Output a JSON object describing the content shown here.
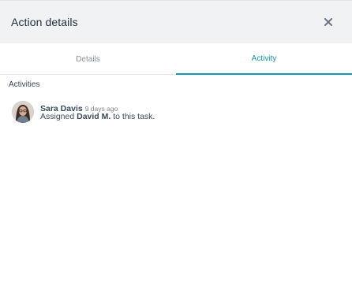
{
  "header": {
    "title": "Action details",
    "close_icon": "close-icon"
  },
  "tabs": [
    {
      "label": "Details",
      "active": false
    },
    {
      "label": "Activity",
      "active": true
    }
  ],
  "activities": {
    "section_label": "Activities",
    "items": [
      {
        "actor": "Sara Davis",
        "time": "9 days ago",
        "text_prefix": "Assigned",
        "target": "David M.",
        "text_suffix": "to this task.",
        "avatar_icon": "user-avatar"
      }
    ]
  },
  "colors": {
    "accent": "#1597b4",
    "header_bg": "#f1f2f4",
    "text": "#3b4a5a"
  }
}
